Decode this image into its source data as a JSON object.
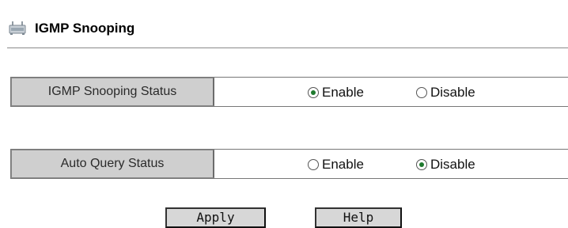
{
  "header": {
    "title": "IGMP Snooping",
    "icon": "router-icon"
  },
  "settings": [
    {
      "label": "IGMP Snooping Status",
      "options": [
        "Enable",
        "Disable"
      ],
      "selected": "Enable"
    },
    {
      "label": "Auto Query Status",
      "options": [
        "Enable",
        "Disable"
      ],
      "selected": "Disable"
    }
  ],
  "buttons": {
    "apply": "Apply",
    "help": "Help"
  },
  "colors": {
    "radio_dot": "#1f7a2e",
    "label_bg": "#cfcfcf",
    "button_bg": "#d7d7d7"
  }
}
